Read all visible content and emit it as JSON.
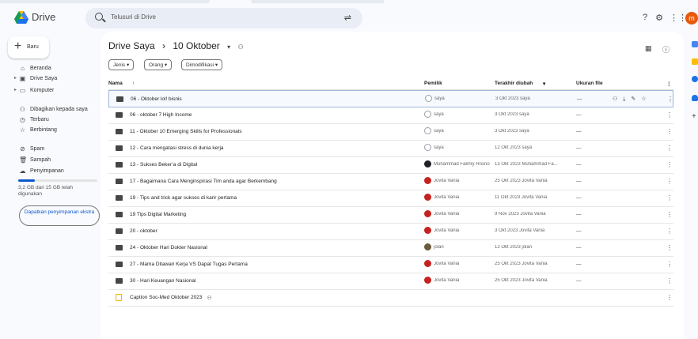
{
  "header": {
    "app_name": "Drive",
    "search_placeholder": "Telusuri di Drive",
    "avatar_letter": "m"
  },
  "sidebar": {
    "new_label": "Baru",
    "items": [
      {
        "label": "Beranda",
        "icon": "home-icon"
      },
      {
        "label": "Drive Saya",
        "icon": "my-drive-icon"
      },
      {
        "label": "Komputer",
        "icon": "computer-icon"
      },
      {
        "label": "Dibagikan kepada saya",
        "icon": "shared-icon"
      },
      {
        "label": "Terbaru",
        "icon": "clock-icon"
      },
      {
        "label": "Berbintang",
        "icon": "star-icon"
      },
      {
        "label": "Spam",
        "icon": "spam-icon"
      },
      {
        "label": "Sampah",
        "icon": "trash-icon"
      },
      {
        "label": "Penyimpanan",
        "icon": "cloud-icon"
      }
    ],
    "storage": {
      "used_fraction": 0.21,
      "text": "3,2 GB dari 15 GB telah digunakan",
      "button_label": "Dapatkan penyimpanan ekstra"
    }
  },
  "main": {
    "breadcrumb": {
      "root": "Drive Saya",
      "separator": "›",
      "current": "10 Oktober",
      "dropdown": "▾"
    },
    "filters": [
      {
        "label": "Jenis"
      },
      {
        "label": "Orang"
      },
      {
        "label": "Dimodifikasi"
      }
    ],
    "columns": {
      "name": "Nama",
      "sort": "↑",
      "owner": "Pemilik",
      "modified": "Terakhir diubah",
      "modified_arrow": "▾",
      "size": "Ukuran file"
    },
    "rows": [
      {
        "name": "06 - Oktober lol! bisnis",
        "owner": "saya",
        "owner_icon": "gray",
        "modified": "3 Okt 2023 saya",
        "size": "—",
        "type": "folder",
        "selected": true
      },
      {
        "name": "06 - oktober 7 High Income",
        "owner": "saya",
        "owner_icon": "gray",
        "modified": "3 Okt 2023 saya",
        "size": "—",
        "type": "folder"
      },
      {
        "name": "11 - Oktober 10 Emerging Skills for Professionals",
        "owner": "saya",
        "owner_icon": "gray",
        "modified": "3 Okt 2023 saya",
        "size": "—",
        "type": "folder"
      },
      {
        "name": "12 - Cara mengatasi stress di dunia kerja",
        "owner": "saya",
        "owner_icon": "gray",
        "modified": "12 Okt 2023 saya",
        "size": "—",
        "type": "folder"
      },
      {
        "name": "13 - Sukses Beker’a di Digital",
        "owner": "Muhammad Fakhry Rosno",
        "owner_icon": "dark",
        "modified": "13 Okt 2023 Muhammad Fa...",
        "size": "—",
        "type": "folder"
      },
      {
        "name": "17 - Bagaimana Cara Menginspirasi Tim anda agar Berkembang",
        "owner": "Jovita Vania",
        "owner_icon": "red",
        "modified": "25 Okt 2023 Jovita Vania",
        "size": "—",
        "type": "folder"
      },
      {
        "name": "19 - Tips and trick agar sukses di karir pertama",
        "owner": "Jovita Vania",
        "owner_icon": "red",
        "modified": "11 Okt 2023 Jovita Vania",
        "size": "—",
        "type": "folder"
      },
      {
        "name": "19 Tips Digital Marketing",
        "owner": "Jovita Vania",
        "owner_icon": "red",
        "modified": "9 Nov 2023 Jovita Vania",
        "size": "—",
        "type": "folder"
      },
      {
        "name": "20 - oktober",
        "owner": "Jovita Vania",
        "owner_icon": "red",
        "modified": "3 Okt 2023 Jovita Vania",
        "size": "—",
        "type": "folder"
      },
      {
        "name": "24 - Oktober Hari Dokter Nasional",
        "owner": "jolan",
        "owner_icon": "photo",
        "modified": "12 Okt 2023 jolan",
        "size": "—",
        "type": "folder"
      },
      {
        "name": "27 - Mama Ditawari Kerja VS Dapat Tugas Pertama",
        "owner": "Jovita Vania",
        "owner_icon": "red",
        "modified": "25 Okt 2023 Jovita Vania",
        "size": "—",
        "type": "folder"
      },
      {
        "name": "30 - Hari Keuangan Nasional",
        "owner": "Jovita Vania",
        "owner_icon": "red",
        "modified": "25 Okt 2023 Jovita Vania",
        "size": "—",
        "type": "folder"
      },
      {
        "name": "Caption Soc-Med Oktober 2023",
        "owner": "",
        "owner_icon": "",
        "modified": "",
        "size": "",
        "type": "doc"
      }
    ]
  }
}
